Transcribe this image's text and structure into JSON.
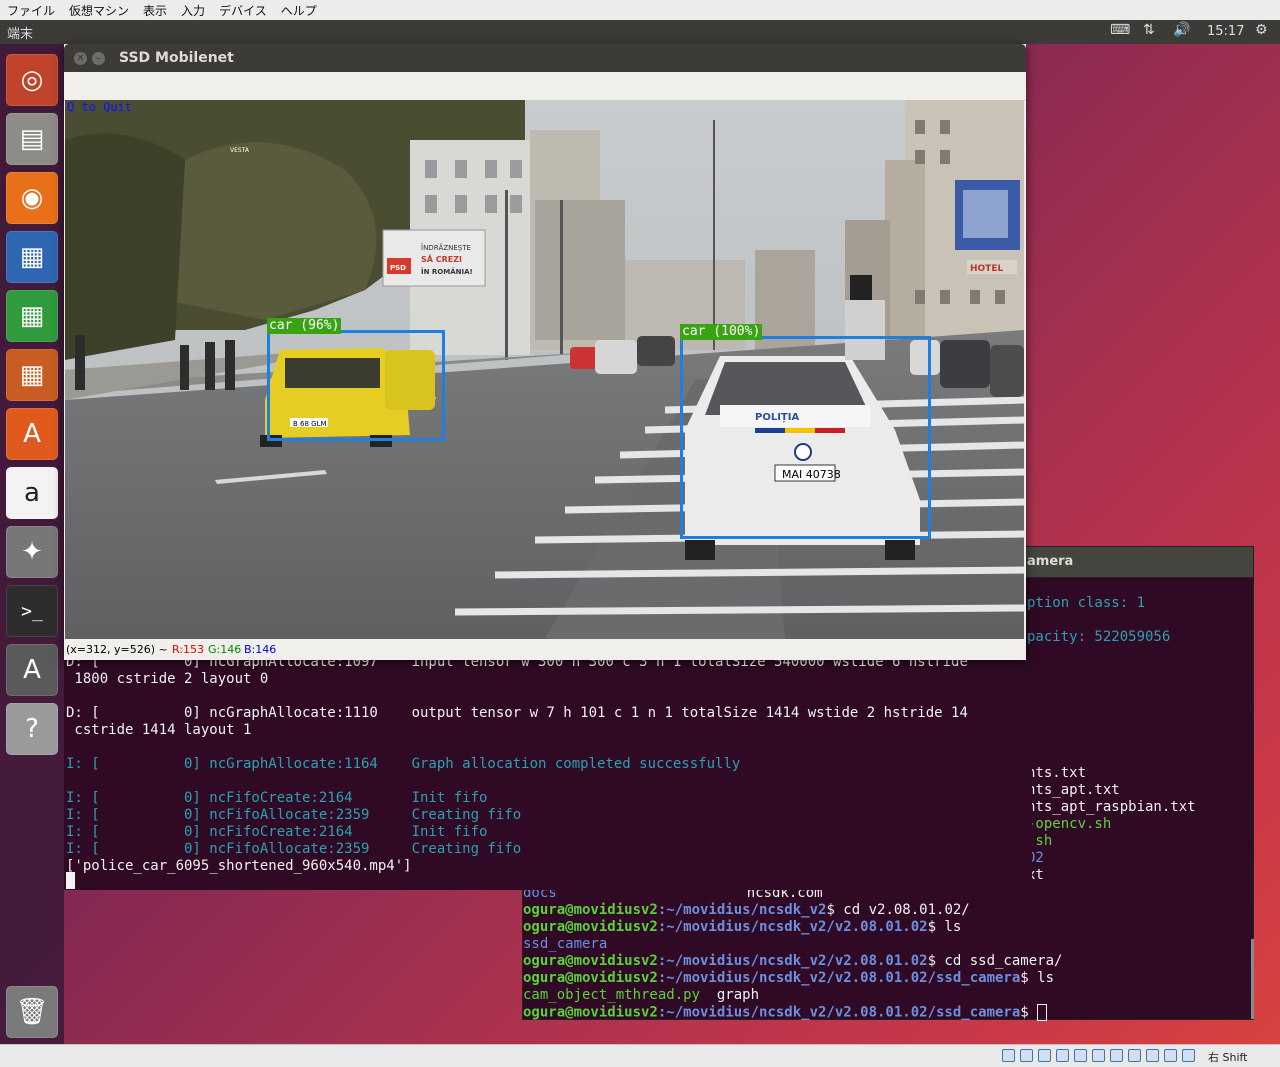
{
  "vbox_menu": [
    "ファイル",
    "仮想マシン",
    "表示",
    "入力",
    "デバイス",
    "ヘルプ"
  ],
  "topbar": {
    "app_title": "端末",
    "time": "15:17"
  },
  "launcher": [
    {
      "name": "ubuntu-dash-icon",
      "glyph": "◎",
      "bg": "#c0432b"
    },
    {
      "name": "files-icon",
      "glyph": "▤",
      "bg": "#8d8c86"
    },
    {
      "name": "firefox-icon",
      "glyph": "◉",
      "bg": "#e8701a"
    },
    {
      "name": "writer-icon",
      "glyph": "▦",
      "bg": "#2f66b2"
    },
    {
      "name": "calc-icon",
      "glyph": "▦",
      "bg": "#2f9b3c"
    },
    {
      "name": "impress-icon",
      "glyph": "▦",
      "bg": "#c95c23"
    },
    {
      "name": "software-center-icon",
      "glyph": "A",
      "bg": "#e05a1e"
    },
    {
      "name": "amazon-icon",
      "glyph": "a",
      "bg": "#f3f3f3"
    },
    {
      "name": "settings-icon",
      "glyph": "✦",
      "bg": "#777"
    },
    {
      "name": "terminal-icon",
      "glyph": ">_",
      "bg": "#2d2d2d"
    },
    {
      "name": "software-updater-icon",
      "glyph": "A",
      "bg": "#5a5a5a"
    },
    {
      "name": "help-icon",
      "glyph": "?",
      "bg": "#9a9a9a"
    }
  ],
  "trash_glyph": "🗑",
  "cv_window": {
    "title": "SSD Mobilenet",
    "quit_hint": "Q to Quit",
    "status_pos": "(x=312, y=526) ~",
    "status_r": "R:153",
    "status_g": "G:146",
    "status_b": "B:146",
    "detections": [
      {
        "label": "car (96%)"
      },
      {
        "label": "car (100%)"
      }
    ],
    "scene_text": {
      "sign1": "ÎNDRĂZNEȘTE",
      "sign2": "SĂ CREZI",
      "sign3": "ÎN ROMÂNIA!",
      "hotel": "HOTEL",
      "plate1": "B 68 GLM",
      "plate2": "MAI 40738",
      "politia": "POLIȚIA",
      "vesta": "VESTA",
      "psd": "PSD"
    }
  },
  "terminal_front": {
    "lines": [
      {
        "text": "D: [          0] ncGraphAllocate:1097    input tensor w 300 h 300 c 3 n 1 totalSize 540000 wstide 6 hstride",
        "cls": ""
      },
      {
        "text": " 1800 cstride 2 layout 0",
        "cls": ""
      },
      {
        "text": "",
        "cls": ""
      },
      {
        "text": "D: [          0] ncGraphAllocate:1110    output tensor w 7 h 101 c 1 n 1 totalSize 1414 wstide 2 hstride 14",
        "cls": ""
      },
      {
        "text": " cstride 1414 layout 1",
        "cls": ""
      },
      {
        "text": "",
        "cls": ""
      },
      {
        "text": "I: [          0] ncGraphAllocate:1164    Graph allocation completed successfully",
        "cls": "cy"
      },
      {
        "text": "",
        "cls": ""
      },
      {
        "text": "I: [          0] ncFifoCreate:2164       Init fifo",
        "cls": "cy"
      },
      {
        "text": "I: [          0] ncFifoAllocate:2359     Creating fifo",
        "cls": "cy"
      },
      {
        "text": "I: [          0] ncFifoCreate:2164       Init fifo",
        "cls": "cy"
      },
      {
        "text": "I: [          0] ncFifoAllocate:2359     Creating fifo",
        "cls": "cy"
      },
      {
        "text": "['police_car_6095_shortened_960x540.mp4']",
        "cls": ""
      }
    ]
  },
  "terminal_back": {
    "title_fragment": "amera",
    "right_lines": [
      {
        "text": "ption class: 1",
        "color": "#2aa1b3"
      },
      {
        "text": "pacity: 522059056",
        "color": "#2aa1b3"
      },
      {
        "text": "nts.txt",
        "color": "#f2f2f2"
      },
      {
        "text": "nts_apt.txt",
        "color": "#f2f2f2"
      },
      {
        "text": "nts_apt_raspbian.txt",
        "color": "#f2f2f2"
      },
      {
        "text": "-opencv.sh",
        "color": "#5ad337"
      },
      {
        "text": ".sh",
        "color": "#5ad337"
      },
      {
        "text": "02",
        "color": "#6d8fe0"
      },
      {
        "text": "xt",
        "color": "#f2f2f2"
      }
    ],
    "partial_line": {
      "a": "docs",
      "b": "ncsdk.com"
    },
    "prompt_user": "ogura@movidiusv2",
    "session": [
      {
        "path": ":~/movidius/ncsdk_v2",
        "cmd": "$ cd v2.08.01.02/"
      },
      {
        "path": ":~/movidius/ncsdk_v2/v2.08.01.02",
        "cmd": "$ ls"
      },
      {
        "out": "ssd_camera",
        "out_color": "#6d8fe0"
      },
      {
        "path": ":~/movidius/ncsdk_v2/v2.08.01.02",
        "cmd": "$ cd ssd_camera/"
      },
      {
        "path": ":~/movidius/ncsdk_v2/v2.08.01.02/ssd_camera",
        "cmd": "$ ls"
      },
      {
        "out": "cam_object_mthread.py",
        "out_color": "#5ad337",
        "out2": "  graph"
      },
      {
        "path": ":~/movidius/ncsdk_v2/v2.08.01.02/ssd_camera",
        "cmd": "$ "
      }
    ]
  },
  "vbox_status": {
    "host_key": "右 Shift"
  }
}
